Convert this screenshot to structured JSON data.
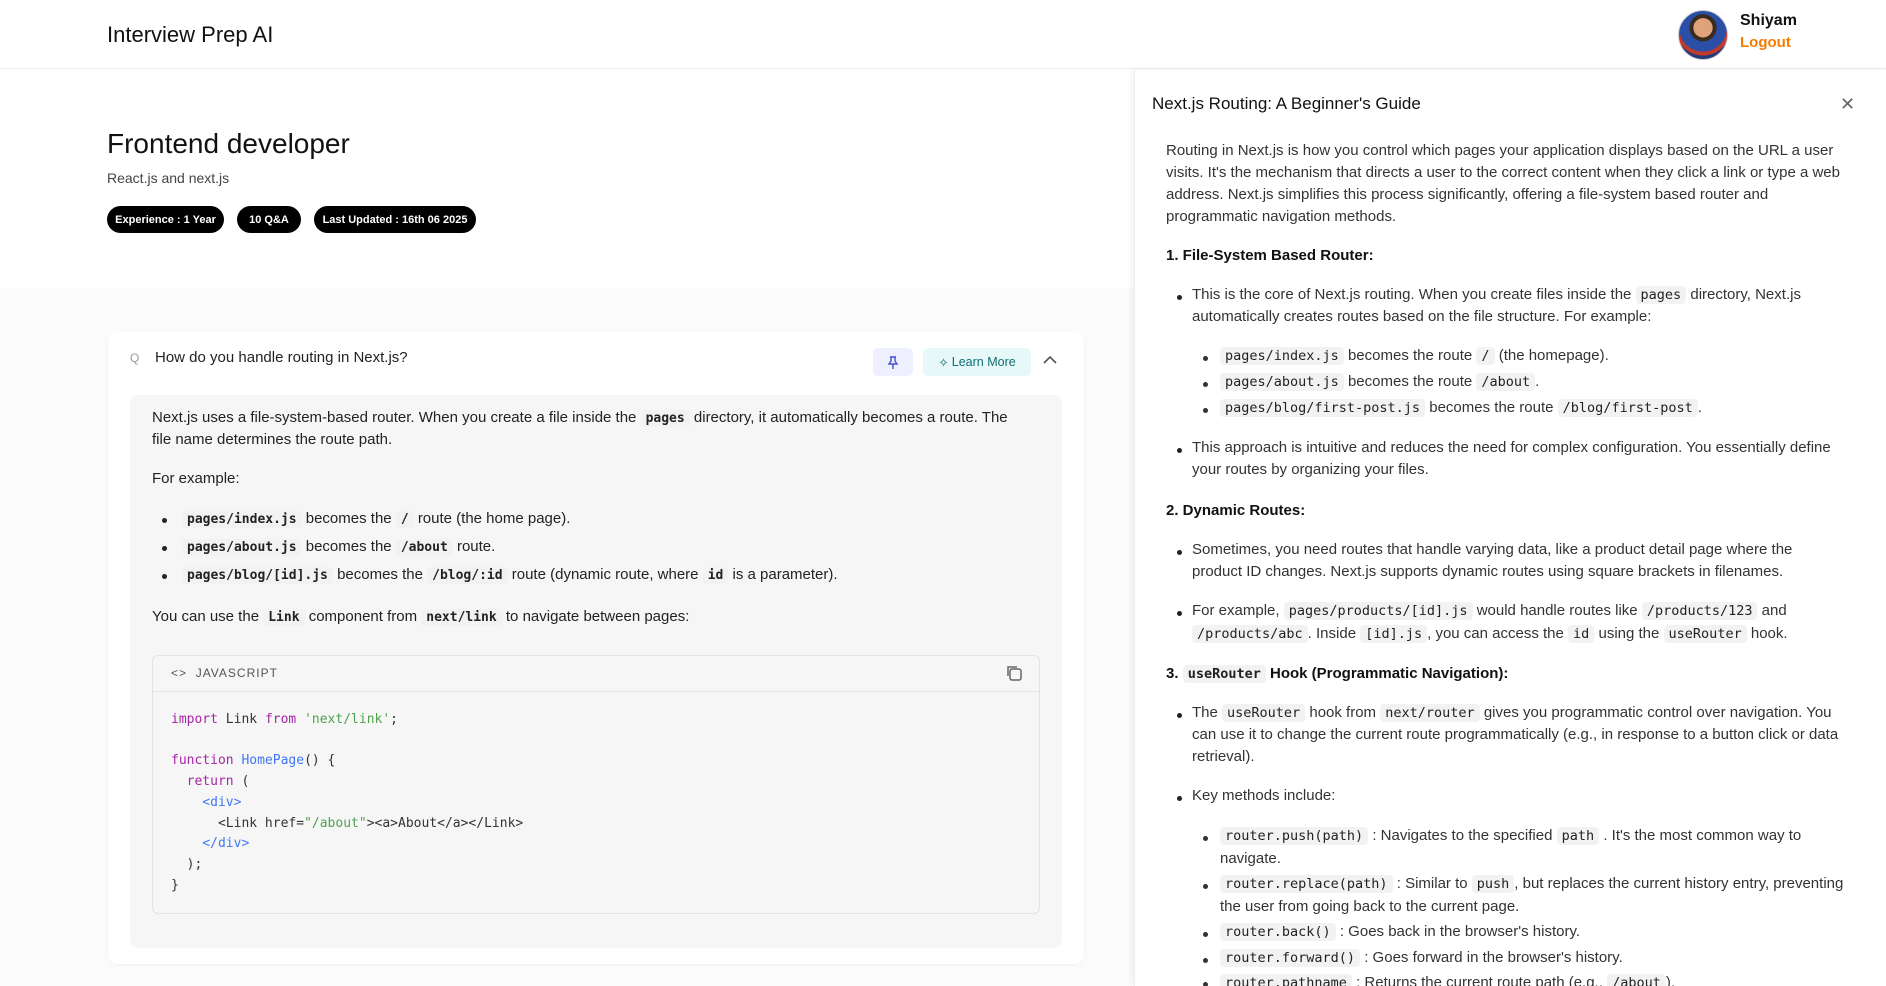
{
  "header": {
    "app_title": "Interview Prep AI",
    "user_name": "Shiyam",
    "logout_label": "Logout"
  },
  "session": {
    "role": "Frontend developer",
    "topics": "React.js and next.js",
    "pills": [
      "Experience : 1 Year",
      "10 Q&A",
      "Last Updated : 16th 06 2025"
    ]
  },
  "qa": {
    "question": "How do you handle routing in Next.js?",
    "learn_more_label": "Learn More",
    "answer": {
      "p1a": "Next.js uses a file-system-based router. When you create a file inside the",
      "p1code": "pages",
      "p1b": "directory, it automatically becomes a route. The",
      "p1c": "file name determines the route path.",
      "p2": "For example:",
      "b1": {
        "c1": "pages/index.js",
        "t1": "becomes the",
        "c2": "/",
        "t2": "route (the home page)."
      },
      "b2": {
        "c1": "pages/about.js",
        "t1": "becomes the",
        "c2": "/about",
        "t2": "route."
      },
      "b3": {
        "c1": "pages/blog/[id].js",
        "t1": "becomes the",
        "c2": "/blog/:id",
        "t2": "route (dynamic route, where",
        "c3": "id",
        "t3": "is a parameter)."
      },
      "p3": {
        "t1": "You can use the",
        "c1": "Link",
        "t2": "component from",
        "c2": "next/link",
        "t3": "to navigate between pages:"
      }
    },
    "code": {
      "language": "JAVASCRIPT",
      "l1": {
        "kw1": "import",
        "t1": " Link ",
        "kw2": "from",
        "s": " 'next/link'",
        "e": ";"
      },
      "l3": {
        "kw": "function",
        "fn": " HomePage",
        "e": "() {"
      },
      "l4": {
        "kw": "  return",
        "e": " ("
      },
      "l5": "    <div>",
      "l6": {
        "a": "      <Link href=",
        "s": "\"/about\"",
        "b": "><a>About</a></Link>"
      },
      "l7": "    </div>",
      "l8": "  );",
      "l9": "}"
    }
  },
  "panel": {
    "title": "Next.js Routing: A Beginner's Guide",
    "intro": [
      "Routing in Next.js is how you control which pages your application displays based on the URL a user",
      "visits. It's the mechanism that directs a user to the correct content when they click a link or type a web",
      "address. Next.js simplifies this process significantly, offering a file-system based router and",
      "programmatic navigation methods."
    ],
    "h1": "1. File-System Based Router:",
    "s1b1": {
      "t1": "This is the core of Next.js routing. When you create files inside the",
      "c1": "pages",
      "t2": "directory, Next.js",
      "t3": "automatically creates routes based on the file structure. For example:"
    },
    "s1sub": [
      {
        "c1": "pages/index.js",
        "t1": "becomes the route",
        "c2": "/",
        "t2": "(the homepage)."
      },
      {
        "c1": "pages/about.js",
        "t1": "becomes the route",
        "c2": "/about",
        "t2": "."
      },
      {
        "c1": "pages/blog/first-post.js",
        "t1": "becomes the route",
        "c2": "/blog/first-post",
        "t2": "."
      }
    ],
    "s1b2": [
      "This approach is intuitive and reduces the need for complex configuration. You essentially define",
      "your routes by organizing your files."
    ],
    "h2": "2. Dynamic Routes:",
    "s2b1": [
      "Sometimes, you need routes that handle varying data, like a product detail page where the",
      "product ID changes. Next.js supports dynamic routes using square brackets in filenames."
    ],
    "s2b2": {
      "t1": "For example,",
      "c1": "pages/products/[id].js",
      "t2": "would handle routes like",
      "c2": "/products/123",
      "t3": "and",
      "c3": "/products/abc",
      "t4": ". Inside",
      "c4": "[id].js",
      "t5": ", you can access the",
      "c5": "id",
      "t6": "using the",
      "c6": "useRouter",
      "t7": "hook."
    },
    "h3": {
      "pre": "3.",
      "code": "useRouter",
      "post": "Hook (Programmatic Navigation):"
    },
    "s3b1": {
      "t1": "The",
      "c1": "useRouter",
      "t2": "hook from",
      "c2": "next/router",
      "t3": "gives you programmatic control over navigation. You",
      "t4": "can use it to change the current route programmatically (e.g., in response to a button click or data",
      "t5": "retrieval)."
    },
    "s3b2": "Key methods include:",
    "s3sub": [
      {
        "c1": "router.push(path)",
        "t1": ": Navigates to the specified",
        "c2": "path",
        "t2": ". It's the most common way to",
        "t3": "navigate."
      },
      {
        "c1": "router.replace(path)",
        "t1": ": Similar to",
        "c2": "push",
        "t2": ", but replaces the current history entry, preventing",
        "t3": "the user from going back to the current page."
      },
      {
        "c1": "router.back()",
        "t1": ": Goes back in the browser's history."
      },
      {
        "c1": "router.forward()",
        "t1": ": Goes forward in the browser's history."
      },
      {
        "c1": "router.pathname",
        "t1": ": Returns the current route path (e.g.,",
        "c2": "/about",
        "t2": ")."
      }
    ]
  }
}
